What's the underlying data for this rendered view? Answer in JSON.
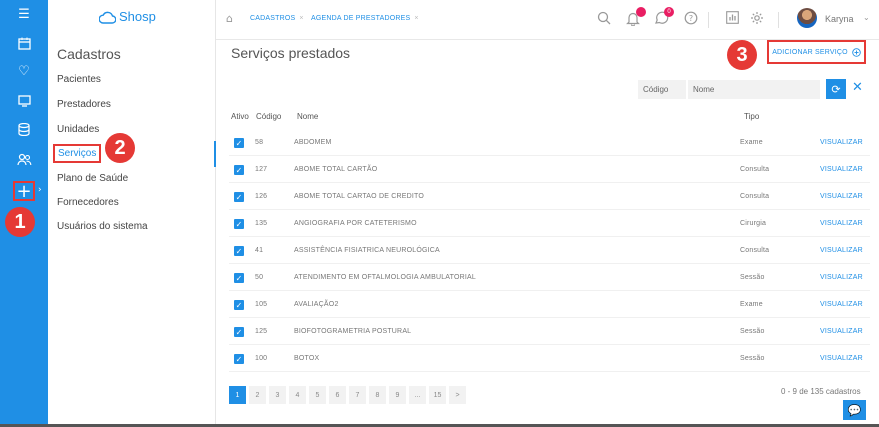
{
  "app": {
    "logo_text": "Shosp"
  },
  "rail": {
    "icons": [
      "menu-icon",
      "calendar-icon",
      "heart-icon",
      "monitor-icon",
      "database-icon",
      "users-icon",
      "plus-icon"
    ]
  },
  "sidebar": {
    "title": "Cadastros",
    "items": [
      {
        "label": "Pacientes"
      },
      {
        "label": "Prestadores"
      },
      {
        "label": "Unidades"
      },
      {
        "label": "Serviços"
      },
      {
        "label": "Plano de Saúde"
      },
      {
        "label": "Fornecedores"
      },
      {
        "label": "Usuários do sistema"
      }
    ]
  },
  "topbar": {
    "breadcrumbs": [
      {
        "label": "CADASTROS"
      },
      {
        "label": "AGENDA DE PRESTADORES"
      }
    ],
    "close_glyph": "×",
    "notification_badge": "",
    "message_badge": "0",
    "user_name": "Karyna"
  },
  "page": {
    "title": "Serviços prestados",
    "add_button_label": "ADICIONAR SERVIÇO"
  },
  "filters": {
    "code_placeholder": "Código",
    "name_placeholder": "Nome"
  },
  "table": {
    "headers": {
      "active": "Ativo",
      "code": "Código",
      "name": "Nome",
      "type": "Tipo"
    },
    "action_label": "VISUALIZAR",
    "rows": [
      {
        "active": true,
        "code": "58",
        "name": "ABDOMEM",
        "type": "Exame"
      },
      {
        "active": true,
        "code": "127",
        "name": "ABOME TOTAL CARTÃO",
        "type": "Consulta"
      },
      {
        "active": true,
        "code": "126",
        "name": "ABOME TOTAL CARTAO DE CREDITO",
        "type": "Consulta"
      },
      {
        "active": true,
        "code": "135",
        "name": "ANGIOGRAFIA POR CATETERISMO",
        "type": "Cirurgia"
      },
      {
        "active": true,
        "code": "41",
        "name": "ASSISTÊNCIA FISIATRICA NEUROLÓGICA",
        "type": "Consulta"
      },
      {
        "active": true,
        "code": "50",
        "name": "ATENDIMENTO EM OFTALMOLOGIA AMBULATORIAL",
        "type": "Sessão"
      },
      {
        "active": true,
        "code": "105",
        "name": "AVALIAÇÃO2",
        "type": "Exame"
      },
      {
        "active": true,
        "code": "125",
        "name": "BIOFOTOGRAMETRIA POSTURAL",
        "type": "Sessão"
      },
      {
        "active": true,
        "code": "100",
        "name": "BOTOX",
        "type": "Sessão"
      }
    ]
  },
  "pagination": {
    "pages": [
      "1",
      "2",
      "3",
      "4",
      "5",
      "6",
      "7",
      "8",
      "9",
      "...",
      "15",
      ">"
    ],
    "current": "1",
    "info": "0 - 9 de 135 cadastros"
  },
  "annotations": {
    "m1": "1",
    "m2": "2",
    "m3": "3"
  },
  "colors": {
    "accent": "#1f8fe5",
    "highlight": "#e53935",
    "badge": "#e91e63"
  }
}
